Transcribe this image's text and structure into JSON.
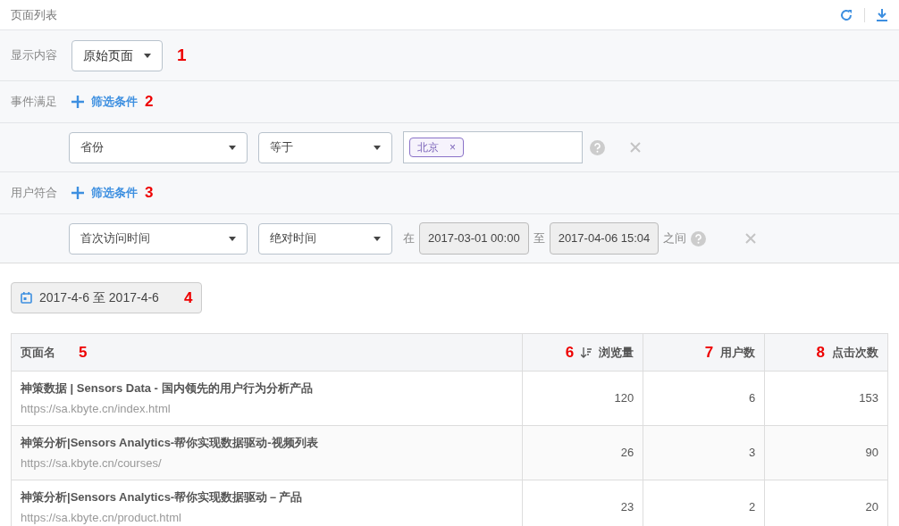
{
  "header": {
    "title": "页面列表"
  },
  "display": {
    "label": "显示内容",
    "value": "原始页面",
    "callout": "1"
  },
  "event_filter": {
    "label": "事件满足",
    "add": "筛选条件",
    "callout": "2",
    "condition": {
      "field": "省份",
      "operator": "等于",
      "tags": [
        "北京"
      ],
      "remove_tag": "×"
    }
  },
  "user_filter": {
    "label": "用户符合",
    "add": "筛选条件",
    "callout": "3",
    "condition": {
      "field": "首次访问时间",
      "operator": "绝对时间",
      "prefix": "在",
      "from": "2017-03-01 00:00",
      "middle": "至",
      "to": "2017-04-06 15:04",
      "suffix": "之间"
    }
  },
  "date_range": {
    "value": "2017-4-6 至 2017-4-6",
    "callout": "4"
  },
  "table": {
    "columns": [
      {
        "label": "页面名",
        "callout": "5",
        "sorted": false
      },
      {
        "label": "浏览量",
        "callout": "6",
        "sorted": true
      },
      {
        "label": "用户数",
        "callout": "7",
        "sorted": false
      },
      {
        "label": "点击次数",
        "callout": "8",
        "sorted": false
      }
    ],
    "rows": [
      {
        "title": "神策数据 | Sensors Data - 国内领先的用户行为分析产品",
        "url": "https://sa.kbyte.cn/index.html",
        "values": [
          "120",
          "6",
          "153"
        ]
      },
      {
        "title": "神策分析|Sensors Analytics-帮你实现数据驱动-视频列表",
        "url": "https://sa.kbyte.cn/courses/",
        "values": [
          "26",
          "3",
          "90"
        ]
      },
      {
        "title": "神策分析|Sensors Analytics-帮你实现数据驱动－产品",
        "url": "https://sa.kbyte.cn/product.html",
        "values": [
          "23",
          "2",
          "20"
        ]
      }
    ]
  }
}
